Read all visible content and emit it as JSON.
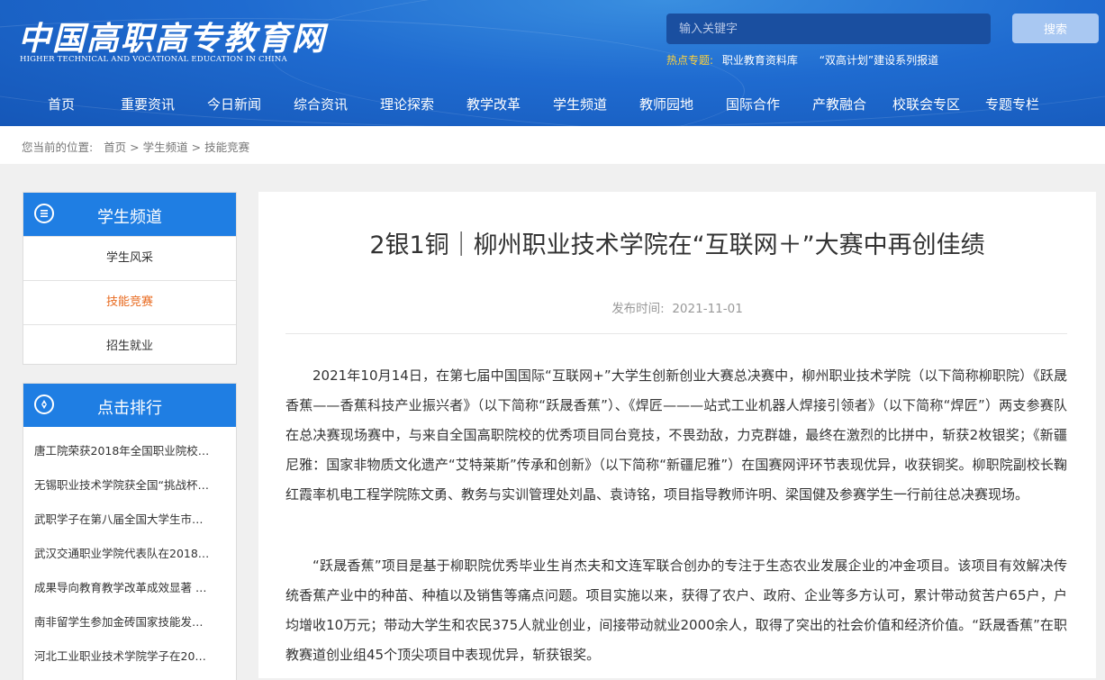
{
  "header": {
    "logo_cn": "中国高职高专教育网",
    "logo_en": "HIGHER TECHNICAL AND VOCATIONAL EDUCATION IN CHINA",
    "search_placeholder": "输入关键字",
    "search_button": "搜索",
    "hot_label": "热点专题:",
    "hot_links": [
      "职业教育资料库",
      "“双高计划”建设系列报道"
    ]
  },
  "nav": [
    "首页",
    "重要资讯",
    "今日新闻",
    "综合资讯",
    "理论探索",
    "教学改革",
    "学生频道",
    "教师园地",
    "国际合作",
    "产教融合",
    "校联会专区",
    "专题专栏"
  ],
  "breadcrumb": {
    "prefix": "您当前的位置:",
    "items": [
      "首页",
      "学生频道",
      "技能竞赛"
    ],
    "sep": ">"
  },
  "sidebar": {
    "channel_title": "学生频道",
    "channel_items": [
      "学生风采",
      "技能竞赛",
      "招生就业"
    ],
    "active_item": "技能竞赛",
    "rank_title": "点击排行",
    "rank_items": [
      "唐工院荣获2018年全国职业院校…",
      "无锡职业技术学院获全国“挑战杯…",
      "武职学子在第八届全国大学生市…",
      "武汉交通职业学院代表队在2018…",
      "成果导向教育教学改革成效显著 …",
      "南非留学生参加金砖国家技能发…",
      "河北工业职业技术学院学子在20…"
    ]
  },
  "article": {
    "title": "2银1铜｜柳州职业技术学院在“互联网＋”大赛中再创佳绩",
    "date_label": "发布时间:",
    "date": "2021-11-01",
    "paragraphs": [
      "2021年10月14日，在第七届中国国际“互联网+”大学生创新创业大赛总决赛中，柳州职业技术学院（以下简称柳职院）《跃晟香蕉——香蕉科技产业振兴者》（以下简称“跃晟香蕉”）、《焊匠———站式工业机器人焊接引领者》（以下简称“焊匠”）两支参赛队在总决赛现场赛中，与来自全国高职院校的优秀项目同台竞技，不畏劲敌，力克群雄，最终在激烈的比拼中，斩获2枚银奖；《新疆尼雅：国家非物质文化遗产“艾特莱斯”传承和创新》（以下简称“新疆尼雅”）在国赛网评环节表现优异，收获铜奖。柳职院副校长鞠红霞率机电工程学院陈文勇、教务与实训管理处刘晶、袁诗铭，项目指导教师许明、梁国健及参赛学生一行前往总决赛现场。",
      "“跃晟香蕉”项目是基于柳职院优秀毕业生肖杰夫和文连军联合创办的专注于生态农业发展企业的冲金项目。该项目有效解决传统香蕉产业中的种苗、种植以及销售等痛点问题。项目实施以来，获得了农户、政府、企业等多方认可，累计带动贫苦户65户，户均增收10万元；带动大学生和农民375人就业创业，间接带动就业2000余人，取得了突出的社会价值和经济价值。“跃晟香蕉”在职教赛道创业组45个顶尖项目中表现优异，斩获银奖。"
    ]
  },
  "colors": {
    "header_blue": "#1f6bd0",
    "side_head_blue": "#1f7ee3",
    "active_orange": "#e86a1f",
    "hot_yellow": "#ffd23a"
  }
}
